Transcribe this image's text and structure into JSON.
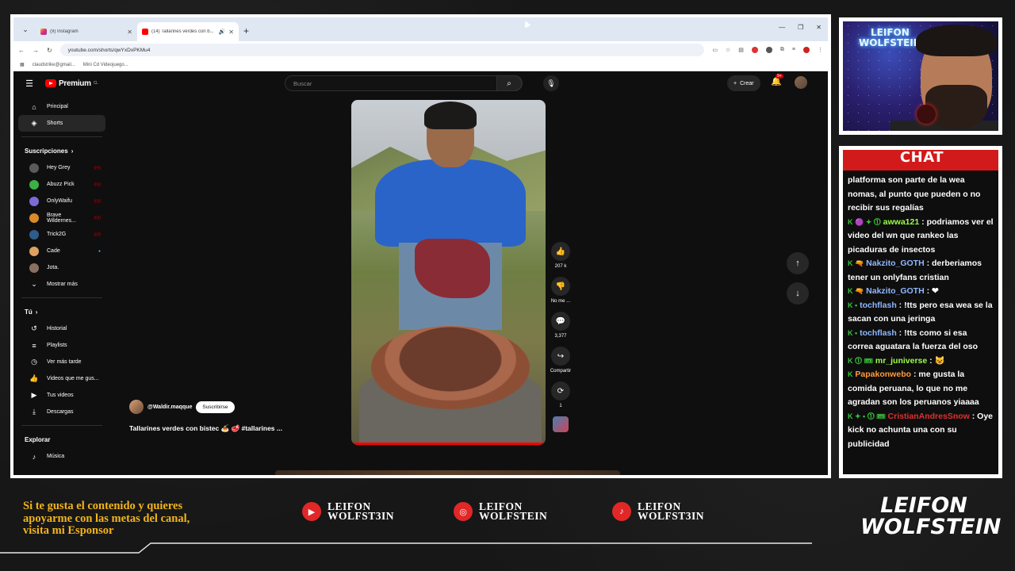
{
  "browser": {
    "tabs": [
      {
        "label": "(9) Instagram",
        "active": false
      },
      {
        "label": "(14) Tallarines verdes con b...",
        "active": true
      }
    ],
    "url": "youtube.com/shorts/qwYxDxPKMu4",
    "bookmarks": [
      "claudstrike@gmail...",
      "Mini Cd Videojuego..."
    ]
  },
  "youtube": {
    "logo": "Premium",
    "logo_region": "CL",
    "search_placeholder": "Buscar",
    "create_label": "Crear",
    "notif_badge": "9+",
    "sidebar": {
      "main": [
        {
          "label": "Principal",
          "icon": "home-icon"
        },
        {
          "label": "Shorts",
          "icon": "shorts-icon",
          "active": true
        }
      ],
      "subs_title": "Suscripciones",
      "subs": [
        {
          "label": "Hey Grey",
          "color": "#5a5a5a",
          "status": "live"
        },
        {
          "label": "Abuzz Pick",
          "color": "#3cb043",
          "status": "live"
        },
        {
          "label": "OnlyWaifu",
          "color": "#7b6bd6",
          "status": "live"
        },
        {
          "label": "Brave Wildernes...",
          "color": "#d98a2b",
          "status": "live"
        },
        {
          "label": "Trick2G",
          "color": "#2e5d8a",
          "status": "live"
        },
        {
          "label": "Cade",
          "color": "#e0a060",
          "status": "new"
        },
        {
          "label": "Jota.",
          "color": "#8a7060",
          "status": ""
        }
      ],
      "show_more": "Mostrar más",
      "you_title": "Tú",
      "you": [
        {
          "label": "Historial",
          "icon": "history-icon"
        },
        {
          "label": "Playlists",
          "icon": "playlist-icon"
        },
        {
          "label": "Ver más tarde",
          "icon": "clock-icon"
        },
        {
          "label": "Videos que me gus...",
          "icon": "like-icon"
        },
        {
          "label": "Tus videos",
          "icon": "video-icon"
        },
        {
          "label": "Descargas",
          "icon": "download-icon"
        }
      ],
      "explore_title": "Explorar",
      "explore": [
        {
          "label": "Música",
          "icon": "music-icon"
        }
      ]
    },
    "short": {
      "channel": "@Waldir.maqque",
      "subscribe": "Suscribirse",
      "title": "Tallarines verdes con bistec 🍝 🥩 #tallarines ...",
      "likes": "207 k",
      "dislike": "No me ...",
      "comments": "3,377",
      "share": "Compartir",
      "remix": "1"
    }
  },
  "chat": {
    "title": "CHAT",
    "messages": [
      {
        "user": "",
        "user_color": "#ffffff",
        "badges": "",
        "text": "platforma son parte de la wea nomas, al punto que pueden o no recibir sus regalías"
      },
      {
        "user": "awwa121",
        "user_color": "#9aff4a",
        "badges": "K 🟣 ✦ ⓵",
        "text": "podriamos ver el video del wn que rankeo las picaduras de insectos"
      },
      {
        "user": "Nakzito_GOTH",
        "user_color": "#8fb8ff",
        "badges": "K 🔫",
        "text": "derberiamos tener un onlyfans cristian"
      },
      {
        "user": "Nakzito_GOTH",
        "user_color": "#8fb8ff",
        "badges": "K 🔫",
        "text": "❤"
      },
      {
        "user": "tochflash",
        "user_color": "#8fb8ff",
        "badges": "K •",
        "text": "!tts pero esa wea se la sacan con una jeringa"
      },
      {
        "user": "tochflash",
        "user_color": "#8fb8ff",
        "badges": "K •",
        "text": "!tts como si esa correa aguatara la fuerza del oso"
      },
      {
        "user": "mr_juniverse",
        "user_color": "#9aff4a",
        "badges": "K ⓵ 🎟",
        "text": "😺"
      },
      {
        "user": "Papakonwebo",
        "user_color": "#ff9b3d",
        "badges": "K",
        "text": "me gusta la comida peruana, lo que no me agradan son los peruanos yiaaaa"
      },
      {
        "user": "CristianAndresSnow",
        "user_color": "#e03030",
        "badges": "K ✦ • ⓵ 🎟",
        "text": "Oye kick no achunta una con su publicidad"
      }
    ]
  },
  "overlay": {
    "sponsor_text": [
      "Si te gusta el contenido y quieres",
      "apoyarme con las metas del canal,",
      "visita mi Esponsor"
    ],
    "socials": [
      {
        "icon": "youtube-icon",
        "line1": "LEIFON",
        "line2": "WOLFST3IN"
      },
      {
        "icon": "instagram-icon",
        "line1": "LEIFON",
        "line2": "WOLFSTEIN"
      },
      {
        "icon": "tiktok-icon",
        "line1": "LEIFON",
        "line2": "WOLFST3IN"
      }
    ],
    "cam_logo": [
      "LEIFON",
      "WOLFSTEIN"
    ],
    "brand": [
      "LEIFON",
      "WOLFSTEIN"
    ],
    "accent": "#d21a1a",
    "sponsor_color": "#f3b51b"
  }
}
